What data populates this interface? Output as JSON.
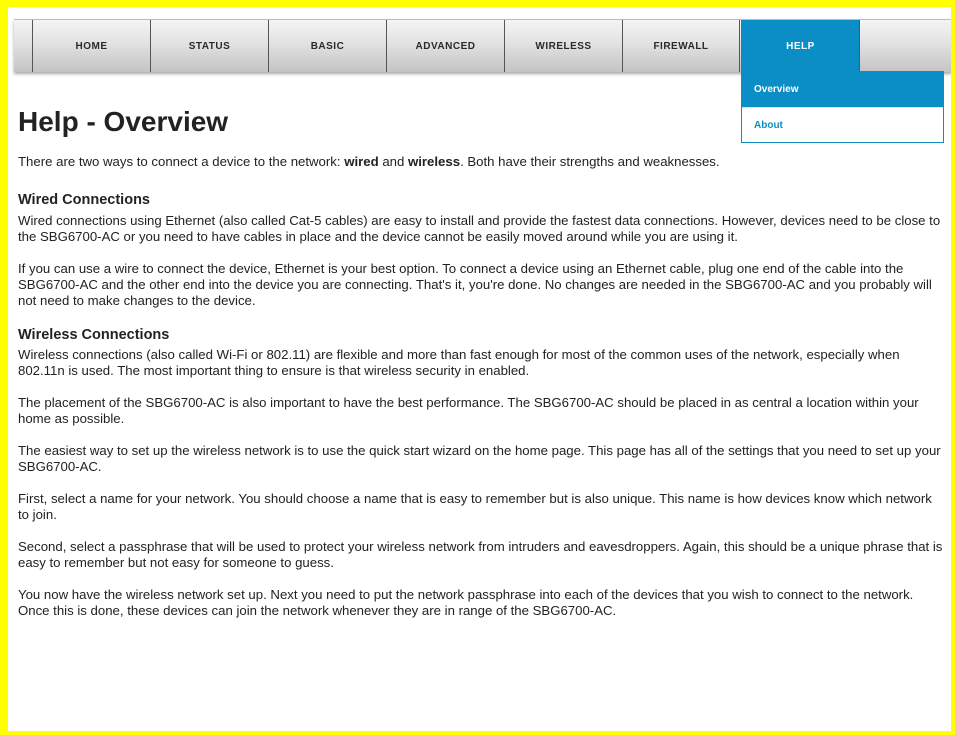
{
  "nav": {
    "items": [
      {
        "label": "HOME"
      },
      {
        "label": "STATUS"
      },
      {
        "label": "BASIC"
      },
      {
        "label": "ADVANCED"
      },
      {
        "label": "WIRELESS"
      },
      {
        "label": "FIREWALL"
      },
      {
        "label": "HELP",
        "active": true
      }
    ],
    "dropdown": {
      "items": [
        {
          "label": "Overview",
          "selected": true
        },
        {
          "label": "About"
        }
      ]
    }
  },
  "colors": {
    "accent": "#0b8ec6",
    "frame": "#ffff00"
  },
  "content": {
    "title": "Help - Overview",
    "intro": {
      "before": "There are two ways to connect a device to the network: ",
      "wired": "wired",
      "and": " and ",
      "wireless": "wireless",
      "after": ". Both have their strengths and weaknesses."
    },
    "wired": {
      "heading": "Wired Connections",
      "p1": "Wired connections using Ethernet (also called Cat-5 cables) are easy to install and provide the fastest data connections. However, devices need to be close to the SBG6700-AC or you need to have cables in place and the device cannot be easily moved around while you are using it.",
      "p2": "If you can use a wire to connect the device, Ethernet is your best option. To connect a device using an Ethernet cable, plug one end of the cable into the SBG6700-AC and the other end into the device you are connecting. That's it, you're done. No changes are needed in the SBG6700-AC and you probably will not need to make changes to the device."
    },
    "wireless": {
      "heading": "Wireless Connections",
      "p1": "Wireless connections (also called Wi-Fi or 802.11) are flexible and more than fast enough for most of the common uses of the network, especially when 802.11n is used. The most important thing to ensure is that wireless security in enabled.",
      "p2": "The placement of the SBG6700-AC is also important to have the best performance. The SBG6700-AC should be placed in as central a location within your home as possible.",
      "p3": "The easiest way to set up the wireless network is to use the quick start wizard on the home page. This page has all of the settings that you need to set up your SBG6700-AC.",
      "p4": "First, select a name for your network. You should choose a name that is easy to remember but is also unique. This name is how devices know which network to join.",
      "p5": "Second, select a passphrase that will be used to protect your wireless network from intruders and eavesdroppers. Again, this should be a unique phrase that is easy to remember but not easy for someone to guess.",
      "p6": "You now have the wireless network set up. Next you need to put the network passphrase into each of the devices that you wish to connect to the network. Once this is done, these devices can join the network whenever they are in range of the SBG6700-AC."
    }
  }
}
